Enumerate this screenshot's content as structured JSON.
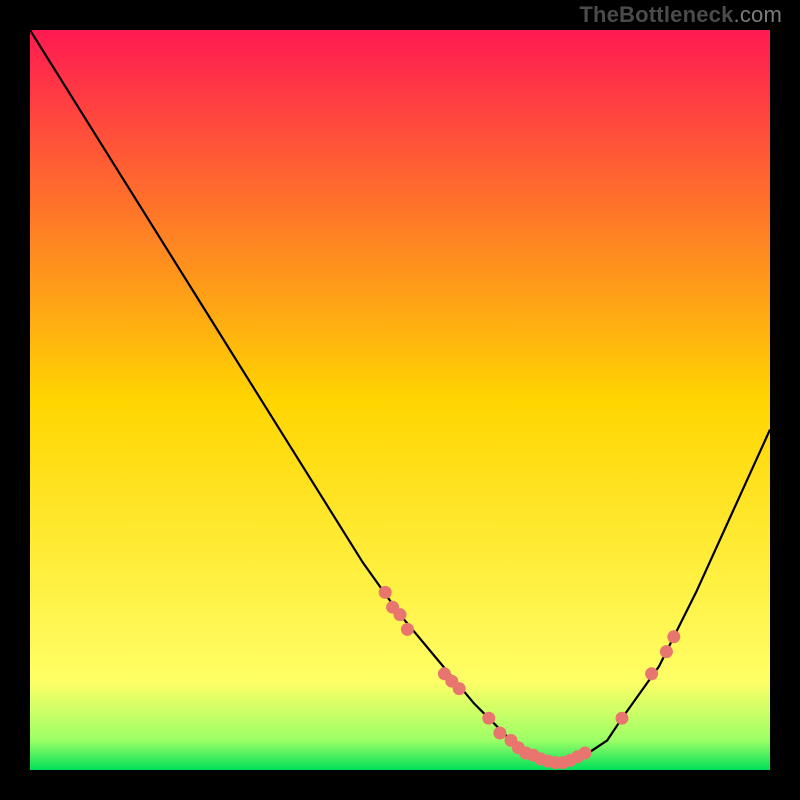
{
  "attribution": {
    "strong": "TheBottleneck",
    "light": ".com"
  },
  "chart_data": {
    "type": "line",
    "title": "",
    "xlabel": "",
    "ylabel": "",
    "xlim": [
      0,
      100
    ],
    "ylim": [
      0,
      100
    ],
    "grid": false,
    "legend": false,
    "background": "heatmap-gradient",
    "gradient_stops": [
      {
        "pos": 0.0,
        "color": "#ff1a51"
      },
      {
        "pos": 0.5,
        "color": "#ffd500"
      },
      {
        "pos": 0.88,
        "color": "#ffff66"
      },
      {
        "pos": 0.96,
        "color": "#9cff66"
      },
      {
        "pos": 1.0,
        "color": "#00e05a"
      }
    ],
    "series": [
      {
        "name": "bottleneck-curve",
        "x": [
          0,
          5,
          10,
          15,
          20,
          25,
          30,
          35,
          40,
          45,
          50,
          55,
          60,
          62,
          65,
          68,
          70,
          72,
          75,
          78,
          80,
          85,
          90,
          95,
          100
        ],
        "y": [
          100,
          92,
          84,
          76,
          68,
          60,
          52,
          44,
          36,
          28,
          21,
          15,
          9,
          7,
          4,
          2,
          1,
          1,
          2,
          4,
          7,
          14,
          24,
          35,
          46
        ]
      }
    ],
    "markers": {
      "name": "highlighted-points",
      "color": "#e9766e",
      "points": [
        {
          "x": 48,
          "y": 24
        },
        {
          "x": 49,
          "y": 22
        },
        {
          "x": 50,
          "y": 21
        },
        {
          "x": 51,
          "y": 19
        },
        {
          "x": 56,
          "y": 13
        },
        {
          "x": 57,
          "y": 12
        },
        {
          "x": 58,
          "y": 11
        },
        {
          "x": 62,
          "y": 7
        },
        {
          "x": 63.5,
          "y": 5
        },
        {
          "x": 65,
          "y": 4
        },
        {
          "x": 66,
          "y": 3
        },
        {
          "x": 67,
          "y": 2.3
        },
        {
          "x": 68,
          "y": 2
        },
        {
          "x": 69,
          "y": 1.5
        },
        {
          "x": 70,
          "y": 1.2
        },
        {
          "x": 71,
          "y": 1
        },
        {
          "x": 72,
          "y": 1
        },
        {
          "x": 73,
          "y": 1.3
        },
        {
          "x": 74,
          "y": 1.8
        },
        {
          "x": 75,
          "y": 2.3
        },
        {
          "x": 80,
          "y": 7
        },
        {
          "x": 84,
          "y": 13
        },
        {
          "x": 86,
          "y": 16
        },
        {
          "x": 87,
          "y": 18
        }
      ]
    }
  }
}
